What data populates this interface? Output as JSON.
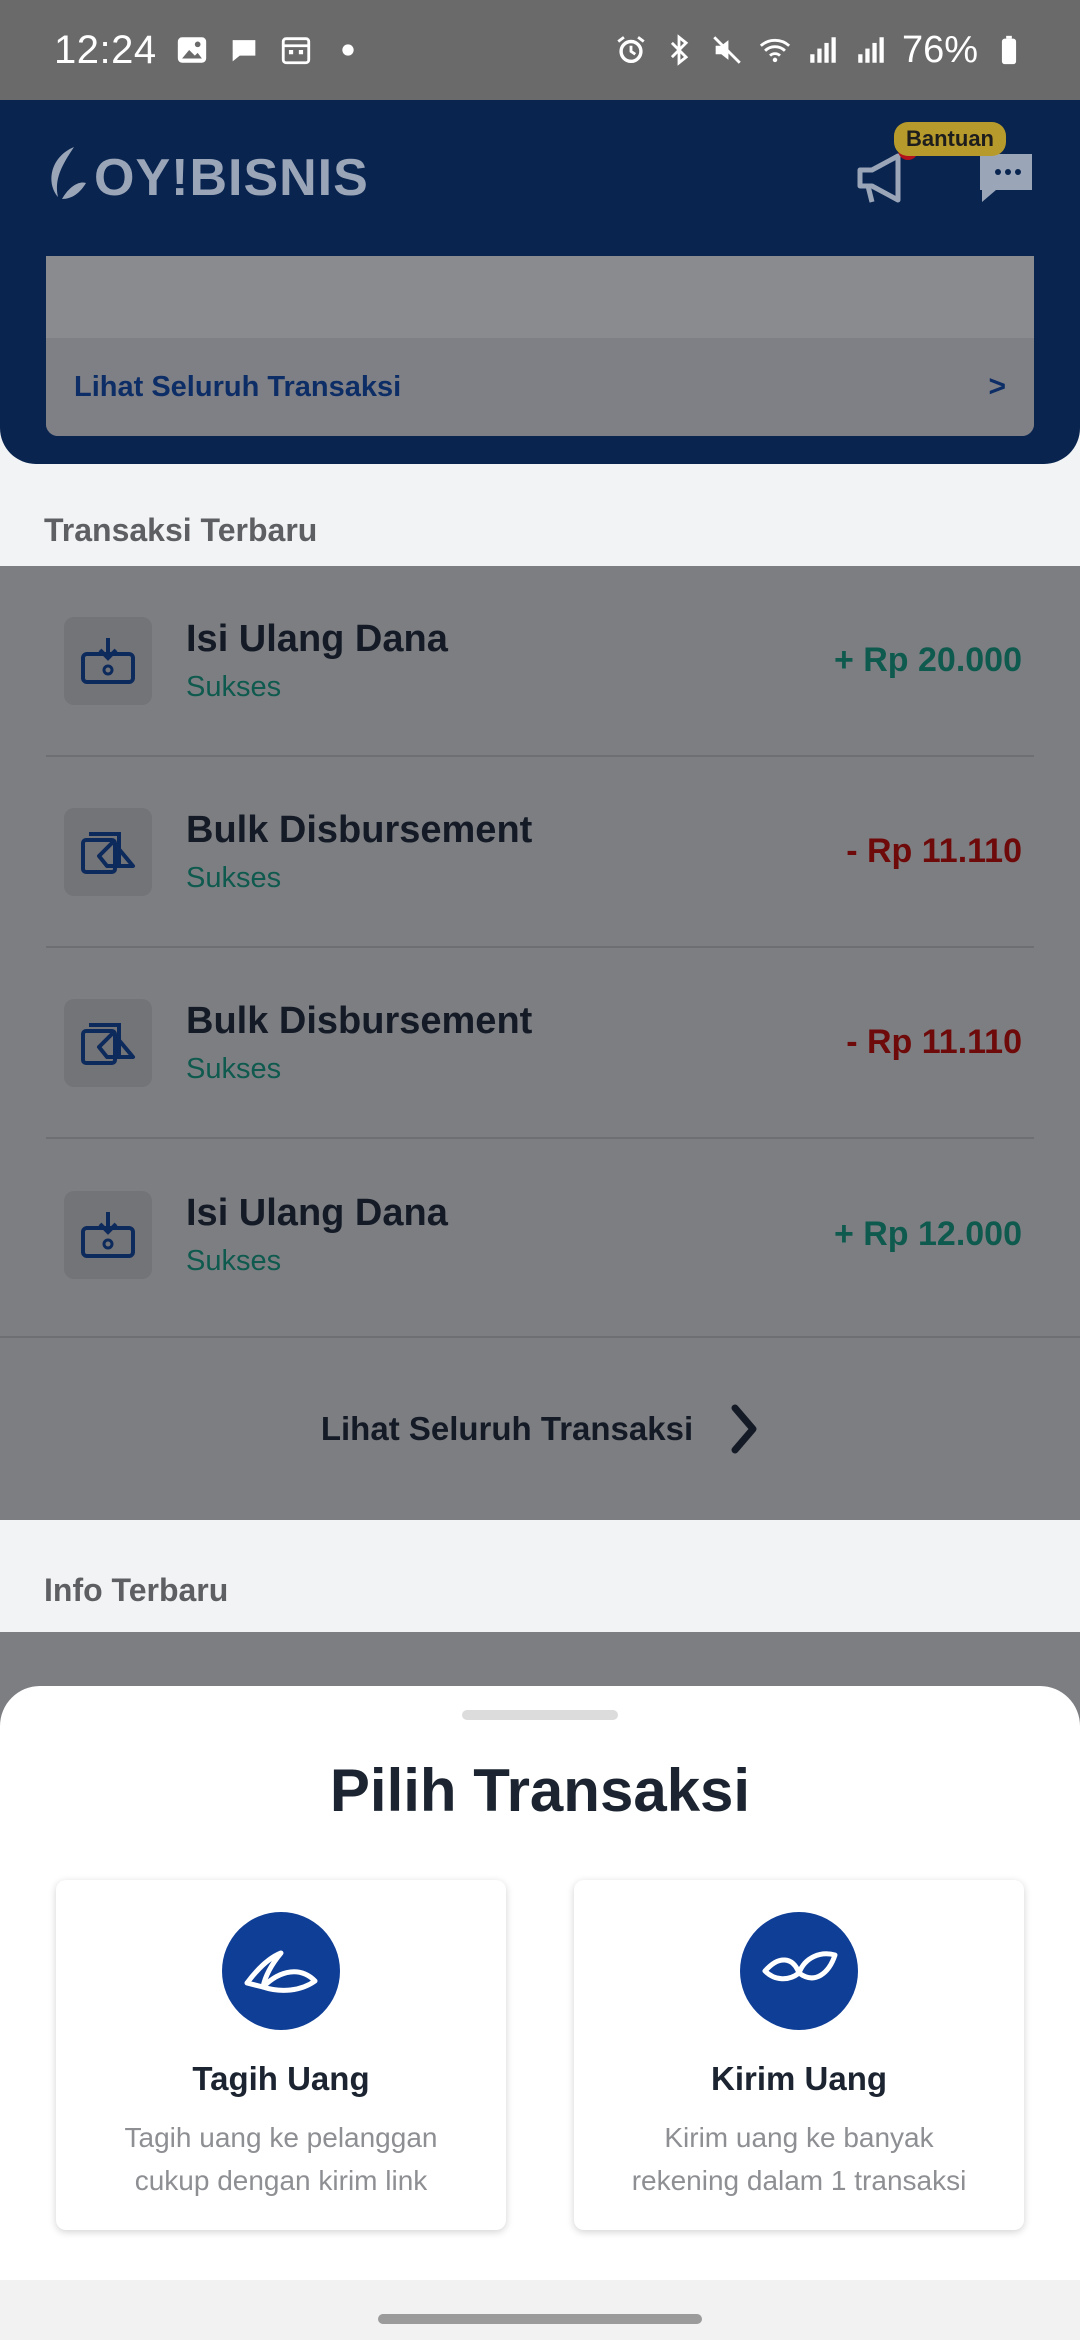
{
  "status_bar": {
    "time": "12:24",
    "battery": "76%",
    "icons_left": [
      "gallery-icon",
      "chat-bubble-icon",
      "calendar-icon",
      "dot-icon"
    ],
    "icons_right": [
      "alarm-icon",
      "bluetooth-icon",
      "mute-icon",
      "wifi-icon",
      "signal-icon",
      "signal-icon",
      "battery-icon"
    ]
  },
  "header": {
    "logo_text": "OY!BISNIS",
    "help_badge": "Bantuan"
  },
  "summary": {
    "see_all_label": "Lihat Seluruh Transaksi",
    "chevron": ">"
  },
  "recent": {
    "heading": "Transaksi Terbaru",
    "items": [
      {
        "title": "Isi Ulang Dana",
        "status": "Sukses",
        "amount": "+ Rp 20.000",
        "icon": "top-up-icon"
      },
      {
        "title": "Bulk Disbursement",
        "status": "Sukses",
        "amount": "- Rp 11.110",
        "icon": "bulk-disbursement-icon"
      },
      {
        "title": "Bulk Disbursement",
        "status": "Sukses",
        "amount": "- Rp 11.110",
        "icon": "bulk-disbursement-icon"
      },
      {
        "title": "Isi Ulang Dana",
        "status": "Sukses",
        "amount": "+ Rp 12.000",
        "icon": "top-up-icon"
      }
    ],
    "see_all_label": "Lihat Seluruh Transaksi"
  },
  "info": {
    "heading": "Info Terbaru"
  },
  "sheet": {
    "title": "Pilih Transaksi",
    "options": [
      {
        "title": "Tagih Uang",
        "desc_line1": "Tagih uang ke pelanggan",
        "desc_line2": "cukup dengan kirim link"
      },
      {
        "title": "Kirim Uang",
        "desc_line1": "Kirim uang ke banyak",
        "desc_line2": "rekening dalam 1 transaksi"
      }
    ]
  },
  "colors": {
    "brand_navy": "#08244f",
    "brand_blue": "#0f3e97",
    "positive": "#2a9d84",
    "negative": "#c01818"
  }
}
